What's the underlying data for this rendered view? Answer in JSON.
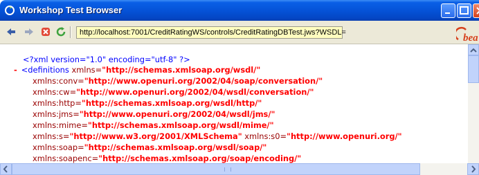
{
  "window": {
    "title": "Workshop Test Browser",
    "icons": {
      "app": "browser-icon",
      "minimize": "minimize-icon",
      "maximize": "maximize-icon",
      "close": "close-icon"
    }
  },
  "toolbar": {
    "address": "http://localhost:7001/CreditRatingWS/controls/CreditRatingDBTest.jws?WSDL=",
    "icons": [
      "back-arrow-icon",
      "forward-arrow-icon",
      "stop-icon",
      "refresh-icon"
    ],
    "logo": "bea"
  },
  "xml": {
    "lines": [
      {
        "dash": "",
        "tag": "<?xml version=\"1.0\" encoding=\"utf-8\" ?>",
        "attr": "",
        "value": "",
        "rest": "",
        "attr2": "",
        "value2": ""
      },
      {
        "dash": "-",
        "tag": "<definitions ",
        "attr": "xmlns=",
        "value": "\"http://schemas.xmlsoap.org/wsdl/\"",
        "rest": "",
        "attr2": "",
        "value2": ""
      },
      {
        "dash": "",
        "tag": "",
        "attr": "xmlns:conv=",
        "value": "\"http://www.openuri.org/2002/04/soap/conversation/\"",
        "rest": "",
        "attr2": "",
        "value2": ""
      },
      {
        "dash": "",
        "tag": "",
        "attr": "xmlns:cw=",
        "value": "\"http://www.openuri.org/2002/04/wsdl/conversation/\"",
        "rest": "",
        "attr2": "",
        "value2": ""
      },
      {
        "dash": "",
        "tag": "",
        "attr": "xmlns:http=",
        "value": "\"http://schemas.xmlsoap.org/wsdl/http/\"",
        "rest": "",
        "attr2": "",
        "value2": ""
      },
      {
        "dash": "",
        "tag": "",
        "attr": "xmlns:jms=",
        "value": "\"http://www.openuri.org/2002/04/wsdl/jms/\"",
        "rest": "",
        "attr2": "",
        "value2": ""
      },
      {
        "dash": "",
        "tag": "",
        "attr": "xmlns:mime=",
        "value": "\"http://schemas.xmlsoap.org/wsdl/mime/\"",
        "rest": "",
        "attr2": "",
        "value2": ""
      },
      {
        "dash": "",
        "tag": "",
        "attr": "xmlns:s=",
        "value": "\"http://www.w3.org/2001/XMLSchema\"",
        "rest": " ",
        "attr2": "xmlns:s0=",
        "value2": "\"http://www.openuri.org/\""
      },
      {
        "dash": "",
        "tag": "",
        "attr": "xmlns:soap=",
        "value": "\"http://schemas.xmlsoap.org/wsdl/soap/\"",
        "rest": "",
        "attr2": "",
        "value2": ""
      },
      {
        "dash": "",
        "tag": "",
        "attr": "xmlns:soapenc=",
        "value": "\"http://schemas.xmlsoap.org/soap/encoding/\"",
        "rest": "",
        "attr2": "",
        "value2": ""
      }
    ]
  }
}
